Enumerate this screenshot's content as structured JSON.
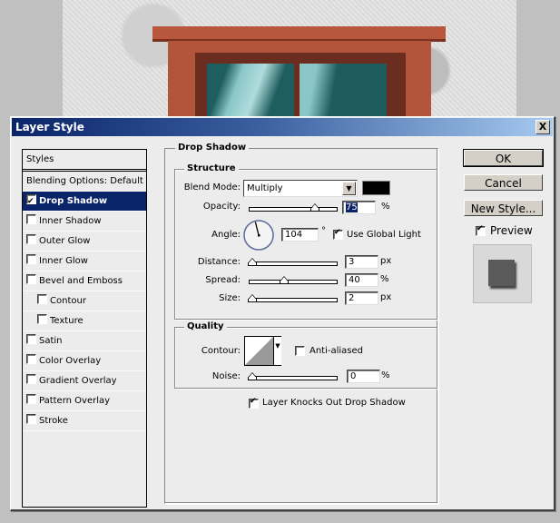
{
  "window": {
    "title": "Layer Style",
    "close_label": "X"
  },
  "styles_panel": {
    "header": "Styles",
    "items": [
      {
        "label": "Blending Options: Default",
        "checkbox": false,
        "checked": false,
        "selected": false,
        "indent": false
      },
      {
        "label": "Drop Shadow",
        "checkbox": true,
        "checked": true,
        "selected": true,
        "indent": false
      },
      {
        "label": "Inner Shadow",
        "checkbox": true,
        "checked": false,
        "selected": false,
        "indent": false
      },
      {
        "label": "Outer Glow",
        "checkbox": true,
        "checked": false,
        "selected": false,
        "indent": false
      },
      {
        "label": "Inner Glow",
        "checkbox": true,
        "checked": false,
        "selected": false,
        "indent": false
      },
      {
        "label": "Bevel and Emboss",
        "checkbox": true,
        "checked": false,
        "selected": false,
        "indent": false
      },
      {
        "label": "Contour",
        "checkbox": true,
        "checked": false,
        "selected": false,
        "indent": true
      },
      {
        "label": "Texture",
        "checkbox": true,
        "checked": false,
        "selected": false,
        "indent": true
      },
      {
        "label": "Satin",
        "checkbox": true,
        "checked": false,
        "selected": false,
        "indent": false
      },
      {
        "label": "Color Overlay",
        "checkbox": true,
        "checked": false,
        "selected": false,
        "indent": false
      },
      {
        "label": "Gradient Overlay",
        "checkbox": true,
        "checked": false,
        "selected": false,
        "indent": false
      },
      {
        "label": "Pattern Overlay",
        "checkbox": true,
        "checked": false,
        "selected": false,
        "indent": false
      },
      {
        "label": "Stroke",
        "checkbox": true,
        "checked": false,
        "selected": false,
        "indent": false
      }
    ]
  },
  "drop_shadow": {
    "title": "Drop Shadow",
    "structure": {
      "title": "Structure",
      "blend_mode_label": "Blend Mode:",
      "blend_mode_value": "Multiply",
      "shadow_color": "#000000",
      "opacity_label": "Opacity:",
      "opacity_value": "75",
      "opacity_unit": "%",
      "opacity_fraction": 0.75,
      "angle_label": "Angle:",
      "angle_value": "104",
      "angle_unit": "°",
      "angle_degrees": 104,
      "use_global_light_label": "Use Global Light",
      "use_global_light_checked": true,
      "distance_label": "Distance:",
      "distance_value": "3",
      "distance_unit": "px",
      "distance_fraction": 0.012,
      "spread_label": "Spread:",
      "spread_value": "40",
      "spread_unit": "%",
      "spread_fraction": 0.4,
      "size_label": "Size:",
      "size_value": "2",
      "size_unit": "px",
      "size_fraction": 0.008
    },
    "quality": {
      "title": "Quality",
      "contour_label": "Contour:",
      "anti_aliased_label": "Anti-aliased",
      "anti_aliased_checked": false,
      "noise_label": "Noise:",
      "noise_value": "0",
      "noise_unit": "%",
      "noise_fraction": 0
    },
    "knockout_label": "Layer Knocks Out Drop Shadow",
    "knockout_checked": true
  },
  "buttons": {
    "ok": "OK",
    "cancel": "Cancel",
    "new_style": "New Style..."
  },
  "preview": {
    "label": "Preview",
    "checked": true
  }
}
